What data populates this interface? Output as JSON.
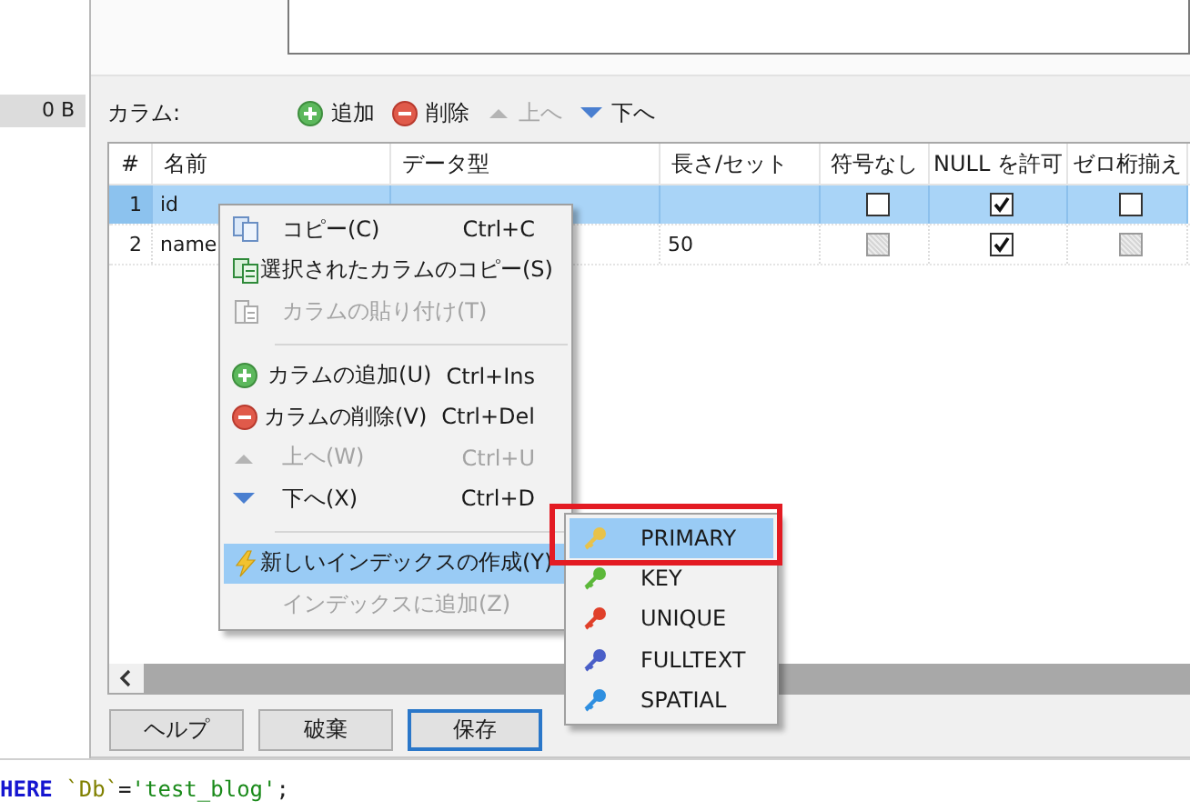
{
  "sidebar": {
    "size": "0 B"
  },
  "columns_toolbar": {
    "label": "カラム:",
    "actions": [
      {
        "kind": "add",
        "label": "追加",
        "disabled": false
      },
      {
        "kind": "remove",
        "label": "削除",
        "disabled": false
      },
      {
        "kind": "up",
        "label": "上へ",
        "disabled": true
      },
      {
        "kind": "down",
        "label": "下へ",
        "disabled": false
      }
    ]
  },
  "table": {
    "columns": [
      "#",
      "名前",
      "データ型",
      "長さ/セット",
      "符号なし",
      "NULL を許可",
      "ゼロ桁揃え"
    ],
    "rows": [
      {
        "num": "1",
        "name": "id",
        "selected": true,
        "unsigned": {
          "checked": false,
          "disabled": false
        },
        "allow_null": {
          "checked": true,
          "disabled": false
        },
        "zerofill": {
          "checked": false,
          "disabled": false
        }
      },
      {
        "num": "2",
        "name": "name",
        "length": "50",
        "selected": false,
        "unsigned": {
          "checked": false,
          "disabled": true
        },
        "allow_null": {
          "checked": true,
          "disabled": false
        },
        "zerofill": {
          "checked": false,
          "disabled": true
        }
      }
    ]
  },
  "buttons": [
    {
      "label": "ヘルプ",
      "focused": false
    },
    {
      "label": "破棄",
      "focused": false
    },
    {
      "label": "保存",
      "focused": true
    }
  ],
  "context_menu": [
    {
      "kind": "copy",
      "label": "コピー(C)",
      "shortcut": "Ctrl+C",
      "disabled": false,
      "selected": false
    },
    {
      "kind": "duplicate",
      "label": "選択されたカラムのコピー(S)",
      "disabled": false,
      "selected": false
    },
    {
      "kind": "paste",
      "label": "カラムの貼り付け(T)",
      "disabled": true,
      "selected": false
    },
    {
      "kind": "separator"
    },
    {
      "kind": "add",
      "label": "カラムの追加(U)",
      "shortcut": "Ctrl+Ins",
      "disabled": false,
      "selected": false
    },
    {
      "kind": "remove",
      "label": "カラムの削除(V)",
      "shortcut": "Ctrl+Del",
      "disabled": false,
      "selected": false
    },
    {
      "kind": "up",
      "label": "上へ(W)",
      "shortcut": "Ctrl+U",
      "disabled": true,
      "selected": false
    },
    {
      "kind": "down",
      "label": "下へ(X)",
      "shortcut": "Ctrl+D",
      "disabled": false,
      "selected": false
    },
    {
      "kind": "separator"
    },
    {
      "kind": "index",
      "label": "新しいインデックスの作成(Y)",
      "disabled": false,
      "selected": true
    },
    {
      "kind": "plain",
      "label": "インデックスに追加(Z)",
      "disabled": true,
      "selected": false
    }
  ],
  "submenu": [
    {
      "label": "PRIMARY",
      "color": "#e8c24a",
      "selected": true,
      "framed": true
    },
    {
      "label": "KEY",
      "color": "#5cb83a",
      "selected": false,
      "framed": false
    },
    {
      "label": "UNIQUE",
      "color": "#e0402a",
      "selected": false,
      "framed": false
    },
    {
      "label": "FULLTEXT",
      "color": "#4a5fc8",
      "selected": false,
      "framed": false
    },
    {
      "label": "SPATIAL",
      "color": "#2f8fe0",
      "selected": false,
      "framed": false
    }
  ],
  "code_line": [
    {
      "kind": "keyword",
      "text": "HERE"
    },
    {
      "kind": "identifier",
      "text": "`Db`"
    },
    {
      "kind": "operator",
      "text": "="
    },
    {
      "kind": "string",
      "text": "'test_blog'"
    },
    {
      "kind": "operator",
      "text": ";"
    }
  ]
}
